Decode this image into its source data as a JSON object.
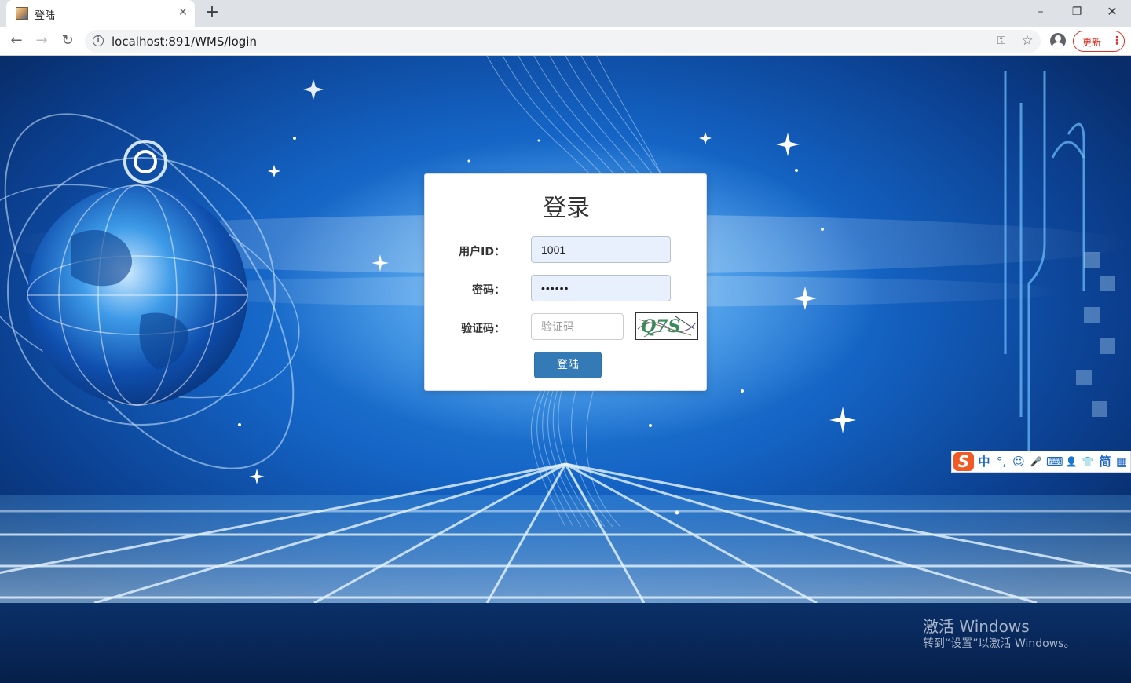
{
  "browser": {
    "tab_title": "登陆",
    "url": "localhost:891/WMS/login",
    "update_label": "更新"
  },
  "login": {
    "title": "登录",
    "user_label": "用户ID：",
    "user_value": "1001",
    "password_label": "密码：",
    "password_value": "••••••",
    "captcha_label": "验证码：",
    "captcha_placeholder": "验证码",
    "captcha_text": "Q7S",
    "submit_label": "登陆"
  },
  "ime": {
    "items": [
      "中",
      "°,",
      "☺",
      "🎤",
      "⌨",
      "👤",
      "👕",
      "简",
      "▦"
    ]
  },
  "watermark": {
    "title": "激活 Windows",
    "subtitle": "转到“设置”以激活 Windows。"
  },
  "colors": {
    "primary_button": "#337ab7",
    "autofill_background": "#e8f0fe",
    "update_accent": "#d93025",
    "ime_logo": "#f15a24"
  },
  "icons": {
    "back": "arrow-left",
    "forward": "arrow-right",
    "reload": "reload",
    "site_info": "info",
    "password_key": "key",
    "bookmark": "star",
    "profile": "account-circle",
    "menu": "vertical-dots"
  }
}
